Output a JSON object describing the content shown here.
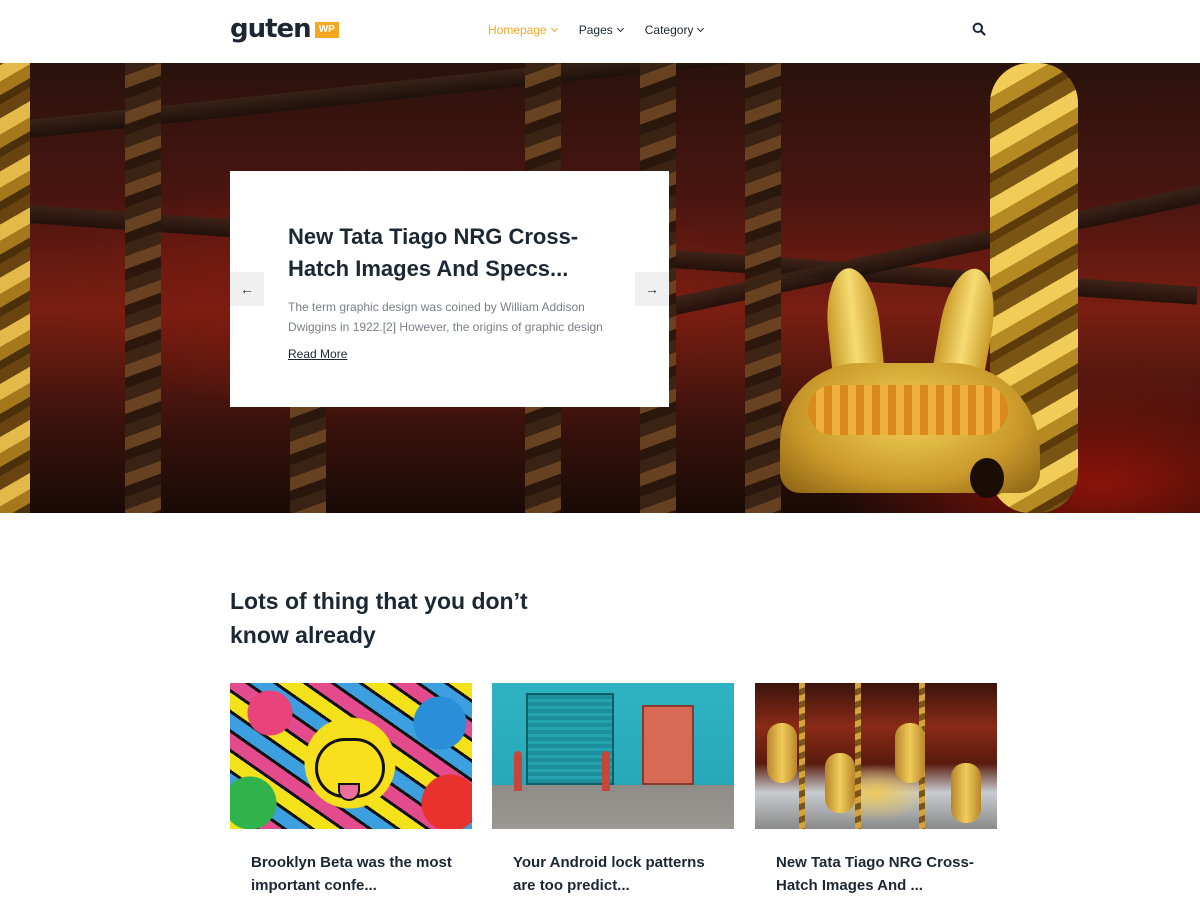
{
  "header": {
    "logo_text": "guten",
    "logo_badge": "WP",
    "nav": [
      {
        "label": "Homepage",
        "active": true
      },
      {
        "label": "Pages",
        "active": false
      },
      {
        "label": "Category",
        "active": false
      }
    ],
    "search_icon": "search-icon"
  },
  "hero": {
    "title": "New Tata Tiago NRG Cross-Hatch Images And Specs...",
    "excerpt": "The term graphic design was coined by William Addison Dwiggins in 1922.[2] However, the origins of graphic design",
    "read_more": "Read More",
    "prev_icon": "arrow-left-icon",
    "next_icon": "arrow-right-icon",
    "prev_glyph": "←",
    "next_glyph": "→"
  },
  "section": {
    "title": "Lots of thing that you don’t know already"
  },
  "posts": [
    {
      "title": "Brooklyn Beta was the most important confe..."
    },
    {
      "title": "Your Android lock patterns are too predict..."
    },
    {
      "title": "New Tata Tiago NRG Cross-Hatch Images And ..."
    }
  ],
  "colors": {
    "accent": "#f5a623",
    "text": "#1c2733",
    "muted": "#7a8088"
  }
}
